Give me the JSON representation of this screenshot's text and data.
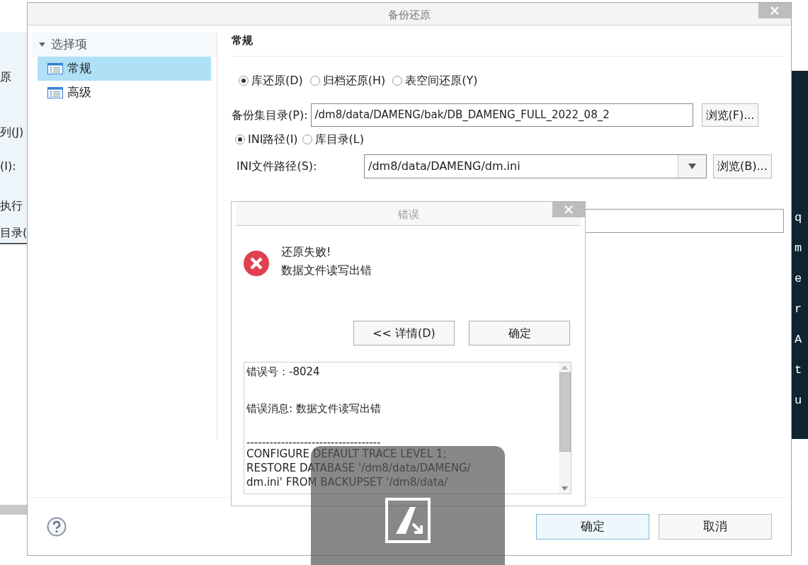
{
  "background_app": {
    "left_labels": [
      "原",
      "列(J)",
      "(I):",
      "执行",
      "目录("
    ],
    "terminal_lines": [
      "q",
      "m",
      "e",
      "r",
      "A",
      "t",
      "u"
    ]
  },
  "dialog": {
    "title": "备份还原",
    "sidebar": {
      "header": "选择项",
      "expanded": true,
      "items": [
        {
          "label": "常规",
          "selected": true
        },
        {
          "label": "高级",
          "selected": false
        }
      ]
    },
    "section_title": "常规",
    "restore_modes": [
      {
        "label": "库还原(D)",
        "selected": true
      },
      {
        "label": "归档还原(H)",
        "selected": false
      },
      {
        "label": "表空间还原(Y)",
        "selected": false
      }
    ],
    "backup_dir": {
      "label": "备份集目录(P):",
      "value": "/dm8/data/DAMENG/bak/DB_DAMENG_FULL_2022_08_2",
      "button": "浏览(F)..."
    },
    "path_modes": [
      {
        "label": "INI路径(I)",
        "selected": true
      },
      {
        "label": "库目录(L)",
        "selected": false
      }
    ],
    "ini_path": {
      "label": "INI文件路径(S):",
      "value": "/dm8/data/DAMENG/dm.ini",
      "button": "浏览(B)..."
    },
    "ok_button": "确定",
    "cancel_button": "取消"
  },
  "error_dialog": {
    "title": "错误",
    "message_lines": [
      "还原失败!",
      "数据文件读写出错"
    ],
    "details_button": "<< 详情(D)",
    "ok_button": "确定",
    "details": {
      "header_lines": [
        "错误号：-8024",
        "错误消息: 数据文件读写出错"
      ],
      "separator": "-----------------------------------",
      "sql_lines": [
        "CONFIGURE DEFAULT TRACE LEVEL 1;",
        "RESTORE DATABASE  '/dm8/data/DAMENG/",
        "dm.ini' FROM BACKUPSET '/dm8/data/"
      ]
    }
  }
}
